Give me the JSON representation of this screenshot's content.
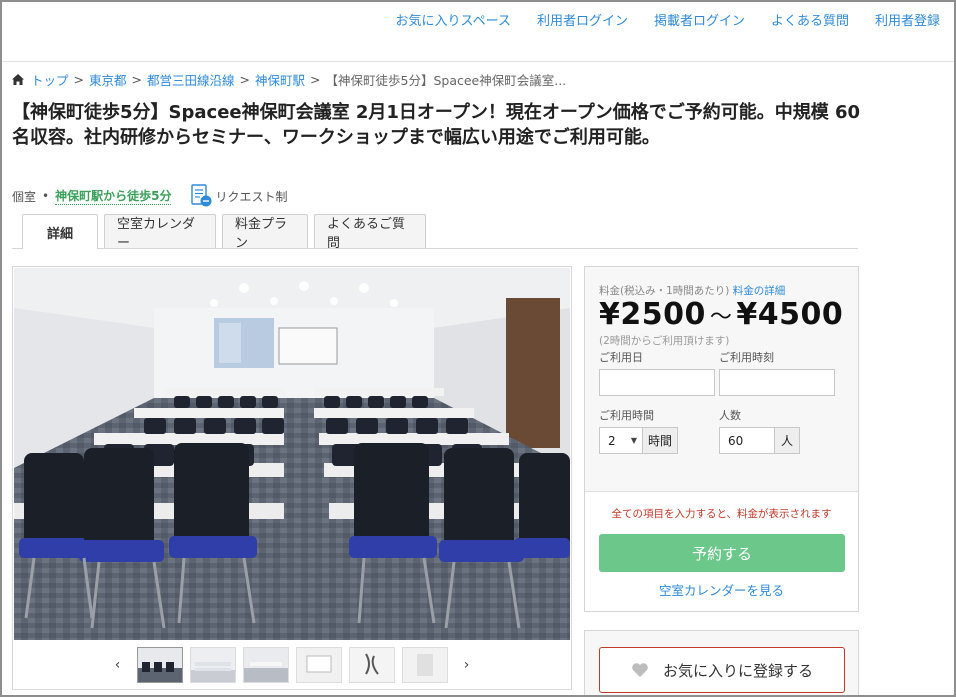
{
  "topnav": {
    "links": [
      "お気に入りスペース",
      "利用者ログイン",
      "掲載者ログイン",
      "よくある質問",
      "利用者登録"
    ]
  },
  "breadcrumb": {
    "items": [
      "トップ",
      "東京都",
      "都営三田線沿線",
      "神保町駅"
    ],
    "current": "【神保町徒歩5分】Spacee神保町会議室..."
  },
  "title": "【神保町徒歩5分】Spacee神保町会議室 2月1日オープン！現在オープン価格でご予約可能。中規模 60名収容。社内研修からセミナー、ワークショップまで幅広い用途でご利用可能。",
  "meta": {
    "room_type": "個室",
    "station": "神保町駅から徒歩5分",
    "request": "リクエスト制"
  },
  "tabs": [
    "詳細",
    "空室カレンダー",
    "料金プラン",
    "よくあるご質問"
  ],
  "booking": {
    "price_label": "料金(税込み・1時間あたり)",
    "price_detail_link": "料金の詳細",
    "price_min": "¥2500",
    "price_sep": "～",
    "price_max": "¥4500",
    "price_note": "(2時間からご利用頂けます)",
    "date_label": "ご利用日",
    "time_label": "ご利用時刻",
    "duration_label": "ご利用時間",
    "duration_value": "2",
    "duration_unit": "時間",
    "people_label": "人数",
    "people_value": "60",
    "people_unit": "人",
    "hint": "全ての項目を入力すると、料金が表示されます",
    "reserve": "予約する",
    "calendar_link": "空室カレンダーを見る"
  },
  "favorite": {
    "label": "お気に入りに登録する"
  },
  "gallery": {
    "prev": "‹",
    "next": "›",
    "thumb_count": 6
  },
  "colors": {
    "link": "#2f8ad8",
    "station_green": "#3aa05a",
    "reserve_green": "#6cc88a",
    "hint_red": "#c0392b"
  }
}
